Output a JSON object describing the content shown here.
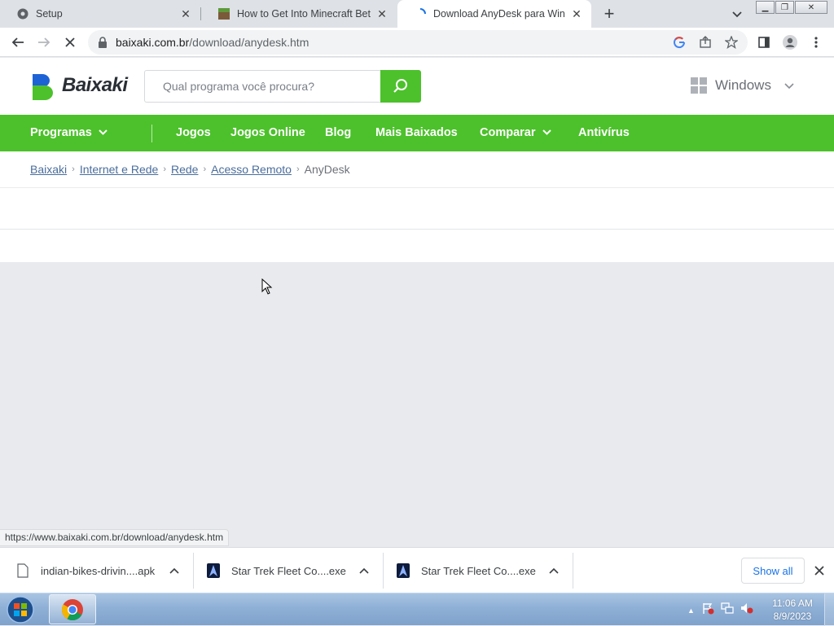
{
  "browser": {
    "tabs": [
      {
        "title": "Setup",
        "icon": "gear-icon"
      },
      {
        "title": "How to Get Into Minecraft Betas",
        "icon": "minecraft-icon"
      },
      {
        "title": "Download AnyDesk para Windows",
        "icon": "loading-spinner-icon"
      }
    ],
    "new_tab": "+",
    "address": {
      "host": "baixaki.com.br",
      "path": "/download/anydesk.htm"
    },
    "status_url": "https://www.baixaki.com.br/download/anydesk.htm"
  },
  "site": {
    "logo_text": "Baixaki",
    "search_placeholder": "Qual programa você procura?",
    "platform": "Windows",
    "nav": [
      "Programas",
      "Jogos",
      "Jogos Online",
      "Blog",
      "Mais Baixados",
      "Comparar",
      "Antivírus"
    ],
    "breadcrumbs": [
      "Baixaki",
      "Internet e Rede",
      "Rede",
      "Acesso Remoto",
      "AnyDesk"
    ],
    "brand_green": "#4cc12b"
  },
  "downloads": {
    "items": [
      "indian-bikes-drivin....apk",
      "Star Trek Fleet Co....exe",
      "Star Trek Fleet Co....exe"
    ],
    "show_all": "Show all"
  },
  "taskbar": {
    "time": "11:06 AM",
    "date": "8/9/2023"
  }
}
